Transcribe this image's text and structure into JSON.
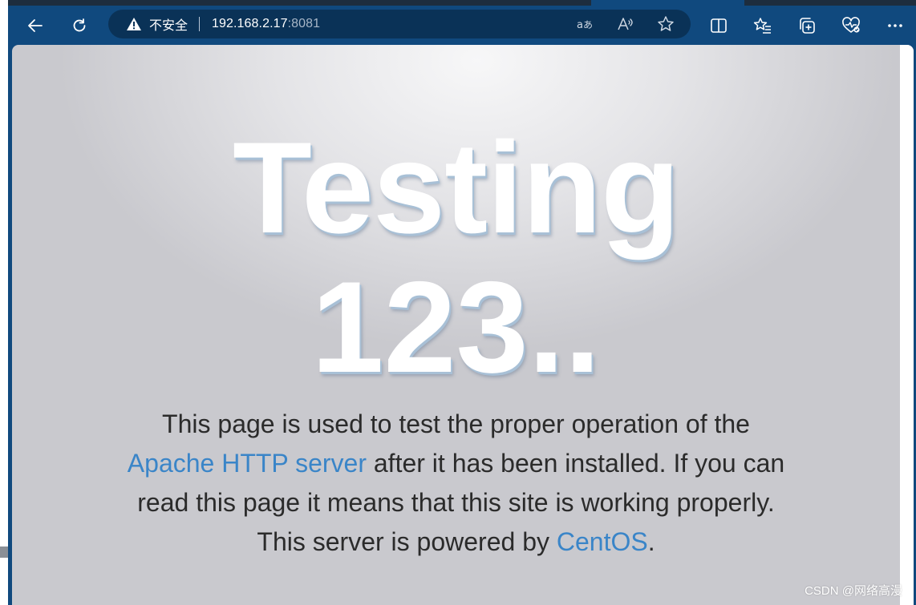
{
  "browser": {
    "security_label": "不安全",
    "url_host": "192.168.2.17",
    "url_port": ":8081",
    "icons": {
      "back": "back-arrow-icon",
      "refresh": "refresh-icon",
      "warning": "warning-triangle-icon",
      "translate": "translate-icon",
      "read_aloud": "read-aloud-icon",
      "favorite": "star-icon",
      "split_screen": "split-screen-icon",
      "favorites": "favorites-list-icon",
      "collections": "collections-icon",
      "performance": "heart-pulse-icon",
      "more": "more-dots-icon"
    }
  },
  "page": {
    "headline_line1": "Testing",
    "headline_line2": "123..",
    "lead_line1": "This page is used to test the proper operation of the",
    "apache_link": "Apache HTTP server",
    "lead_line2_rest": " after it has been installed. If you can",
    "lead_line3": "read this page it means that this site is working properly.",
    "lead_line4_pre": "This server is powered by ",
    "centos_link": "CentOS",
    "lead_line4_post": "."
  },
  "watermark": "CSDN @网络高漫",
  "colors": {
    "chrome": "#10497e",
    "address_bar": "#0a3257",
    "link": "#3a85c8",
    "text": "#2b2b2b"
  }
}
